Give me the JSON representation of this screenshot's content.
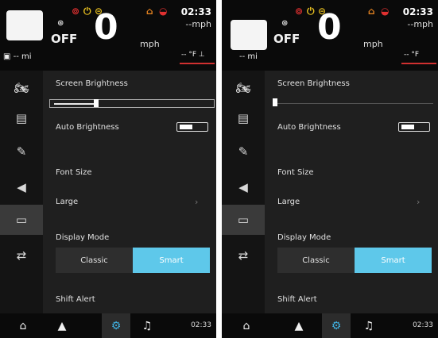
{
  "screens": [
    {
      "status": {
        "gear": "OFF",
        "speed": "0",
        "speed_unit": "mph",
        "time": "02:33",
        "alt_speed": "--mph",
        "range": "-- mi",
        "temp": "-- °F"
      },
      "settings": {
        "brightness_label": "Screen Brightness",
        "brightness_level": 0.27,
        "auto_brightness_label": "Auto Brightness",
        "font_size_label": "Font Size",
        "font_size_value": "Large",
        "display_mode_label": "Display Mode",
        "modes": [
          "Classic",
          "Smart"
        ],
        "active_mode": "Smart",
        "shift_alert_label": "Shift Alert"
      },
      "bottom_time": "02:33"
    },
    {
      "status": {
        "gear": "OFF",
        "speed": "0",
        "speed_unit": "mph",
        "time": "02:33",
        "alt_speed": "--mph",
        "range": "-- mi",
        "temp": "-- °F"
      },
      "settings": {
        "brightness_label": "Screen Brightness",
        "brightness_level": 0.0,
        "auto_brightness_label": "Auto Brightness",
        "font_size_label": "Font Size",
        "font_size_value": "Large",
        "display_mode_label": "Display Mode",
        "modes": [
          "Classic",
          "Smart"
        ],
        "active_mode": "Smart",
        "shift_alert_label": "Shift Alert"
      },
      "bottom_time": "02:33"
    }
  ],
  "icons": {
    "sidebar": [
      "motorcycle-icon",
      "dashboard-icon",
      "wrench-icon",
      "sound-icon",
      "display-icon",
      "controls-icon"
    ],
    "sidebar_selected": "display-icon",
    "bottom": [
      "home-icon",
      "navigation-icon",
      "settings-icon",
      "music-icon"
    ],
    "bottom_selected": "settings-icon"
  },
  "colors": {
    "accent": "#5ec8ea",
    "warning_red": "#e03030",
    "warning_yellow": "#e8c020"
  }
}
